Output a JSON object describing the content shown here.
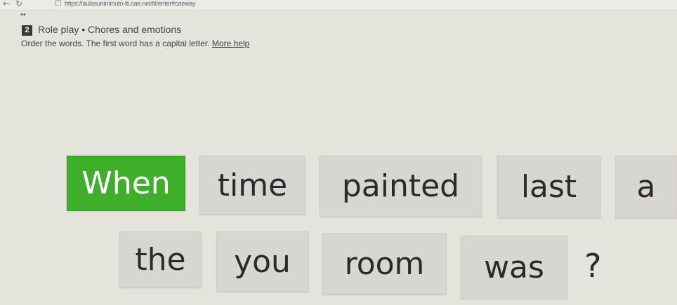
{
  "browser": {
    "back_icon": "arrow-left-icon",
    "reload_icon": "reload-icon",
    "url": "https://aulasuniminuto-lti.cae.net/lti/enter#caeway"
  },
  "activity": {
    "number": "2",
    "title": "Role play • Chores and emotions",
    "instructions": "Order the words. The first word has a capital letter.",
    "help_link": "More help"
  },
  "words": {
    "w1": "When",
    "w2": "time",
    "w3": "painted",
    "w4": "last",
    "w5": "a",
    "w6": "the",
    "w7": "you",
    "w8": "room",
    "w9": "was"
  },
  "punctuation": "?",
  "colors": {
    "selected_tile": "#3fae2b",
    "tile": "#d8d6d0",
    "background": "#e4e3dc"
  }
}
